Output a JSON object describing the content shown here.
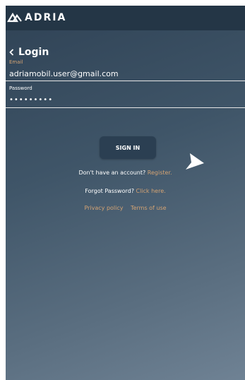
{
  "app": {
    "brand": "ADRIA"
  },
  "header": {
    "title": "Login"
  },
  "form": {
    "email_label": "Email",
    "email_value": "adriamobil.user@gmail.com",
    "password_label": "Password",
    "password_value": "•••••••••"
  },
  "actions": {
    "sign_in_label": "SIGN IN",
    "no_account_text": "Don't have an account?",
    "register_link": "Register.",
    "forgot_text": "Forgot Password?",
    "forgot_link": "Click here.",
    "privacy_link": "Privacy policy",
    "terms_link": "Terms of use"
  },
  "colors": {
    "accent": "#d4a373",
    "topbar": "#243646",
    "button": "#2b3f52"
  },
  "icons": {
    "logo": "adria-logo-icon",
    "back": "chevron-left-icon",
    "cursor": "pointer-cursor-icon"
  }
}
